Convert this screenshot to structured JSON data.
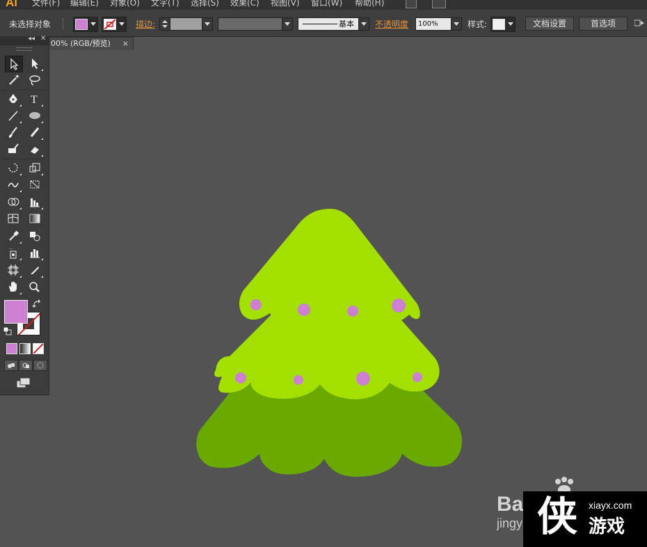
{
  "app": {
    "logo": "Ai"
  },
  "menubar": {
    "items": [
      "文件(F)",
      "编辑(E)",
      "对象(O)",
      "文字(T)",
      "选择(S)",
      "效果(C)",
      "视图(V)",
      "窗口(W)",
      "帮助(H)"
    ]
  },
  "controlbar": {
    "selection_status": "未选择对象",
    "fill_color": "#cd7fd1",
    "stroke_label": "描边:",
    "stroke_profile": "基本",
    "opacity_label": "不透明度",
    "opacity_value": "100%",
    "style_label": "样式:",
    "doc_setup_button": "文档设置",
    "preferences_button": "首选项"
  },
  "document_tab": {
    "title": "00% (RGB/预览)",
    "close": "×"
  },
  "tools_panel": {
    "collapse": "◂◂",
    "close": "✕",
    "fill_color": "#cd7fd1",
    "stroke_color": "none"
  },
  "artwork": {
    "colors": {
      "canvas": "#535353",
      "tree_top": "#a3e000",
      "tree_bottom": "#6aaa00",
      "ornament": "#cd7fd1"
    }
  },
  "watermark": {
    "baidu": "Bai",
    "jingyan": "jingyan",
    "site": "xiayx.com",
    "brand": "游戏",
    "big_char": "侠"
  }
}
